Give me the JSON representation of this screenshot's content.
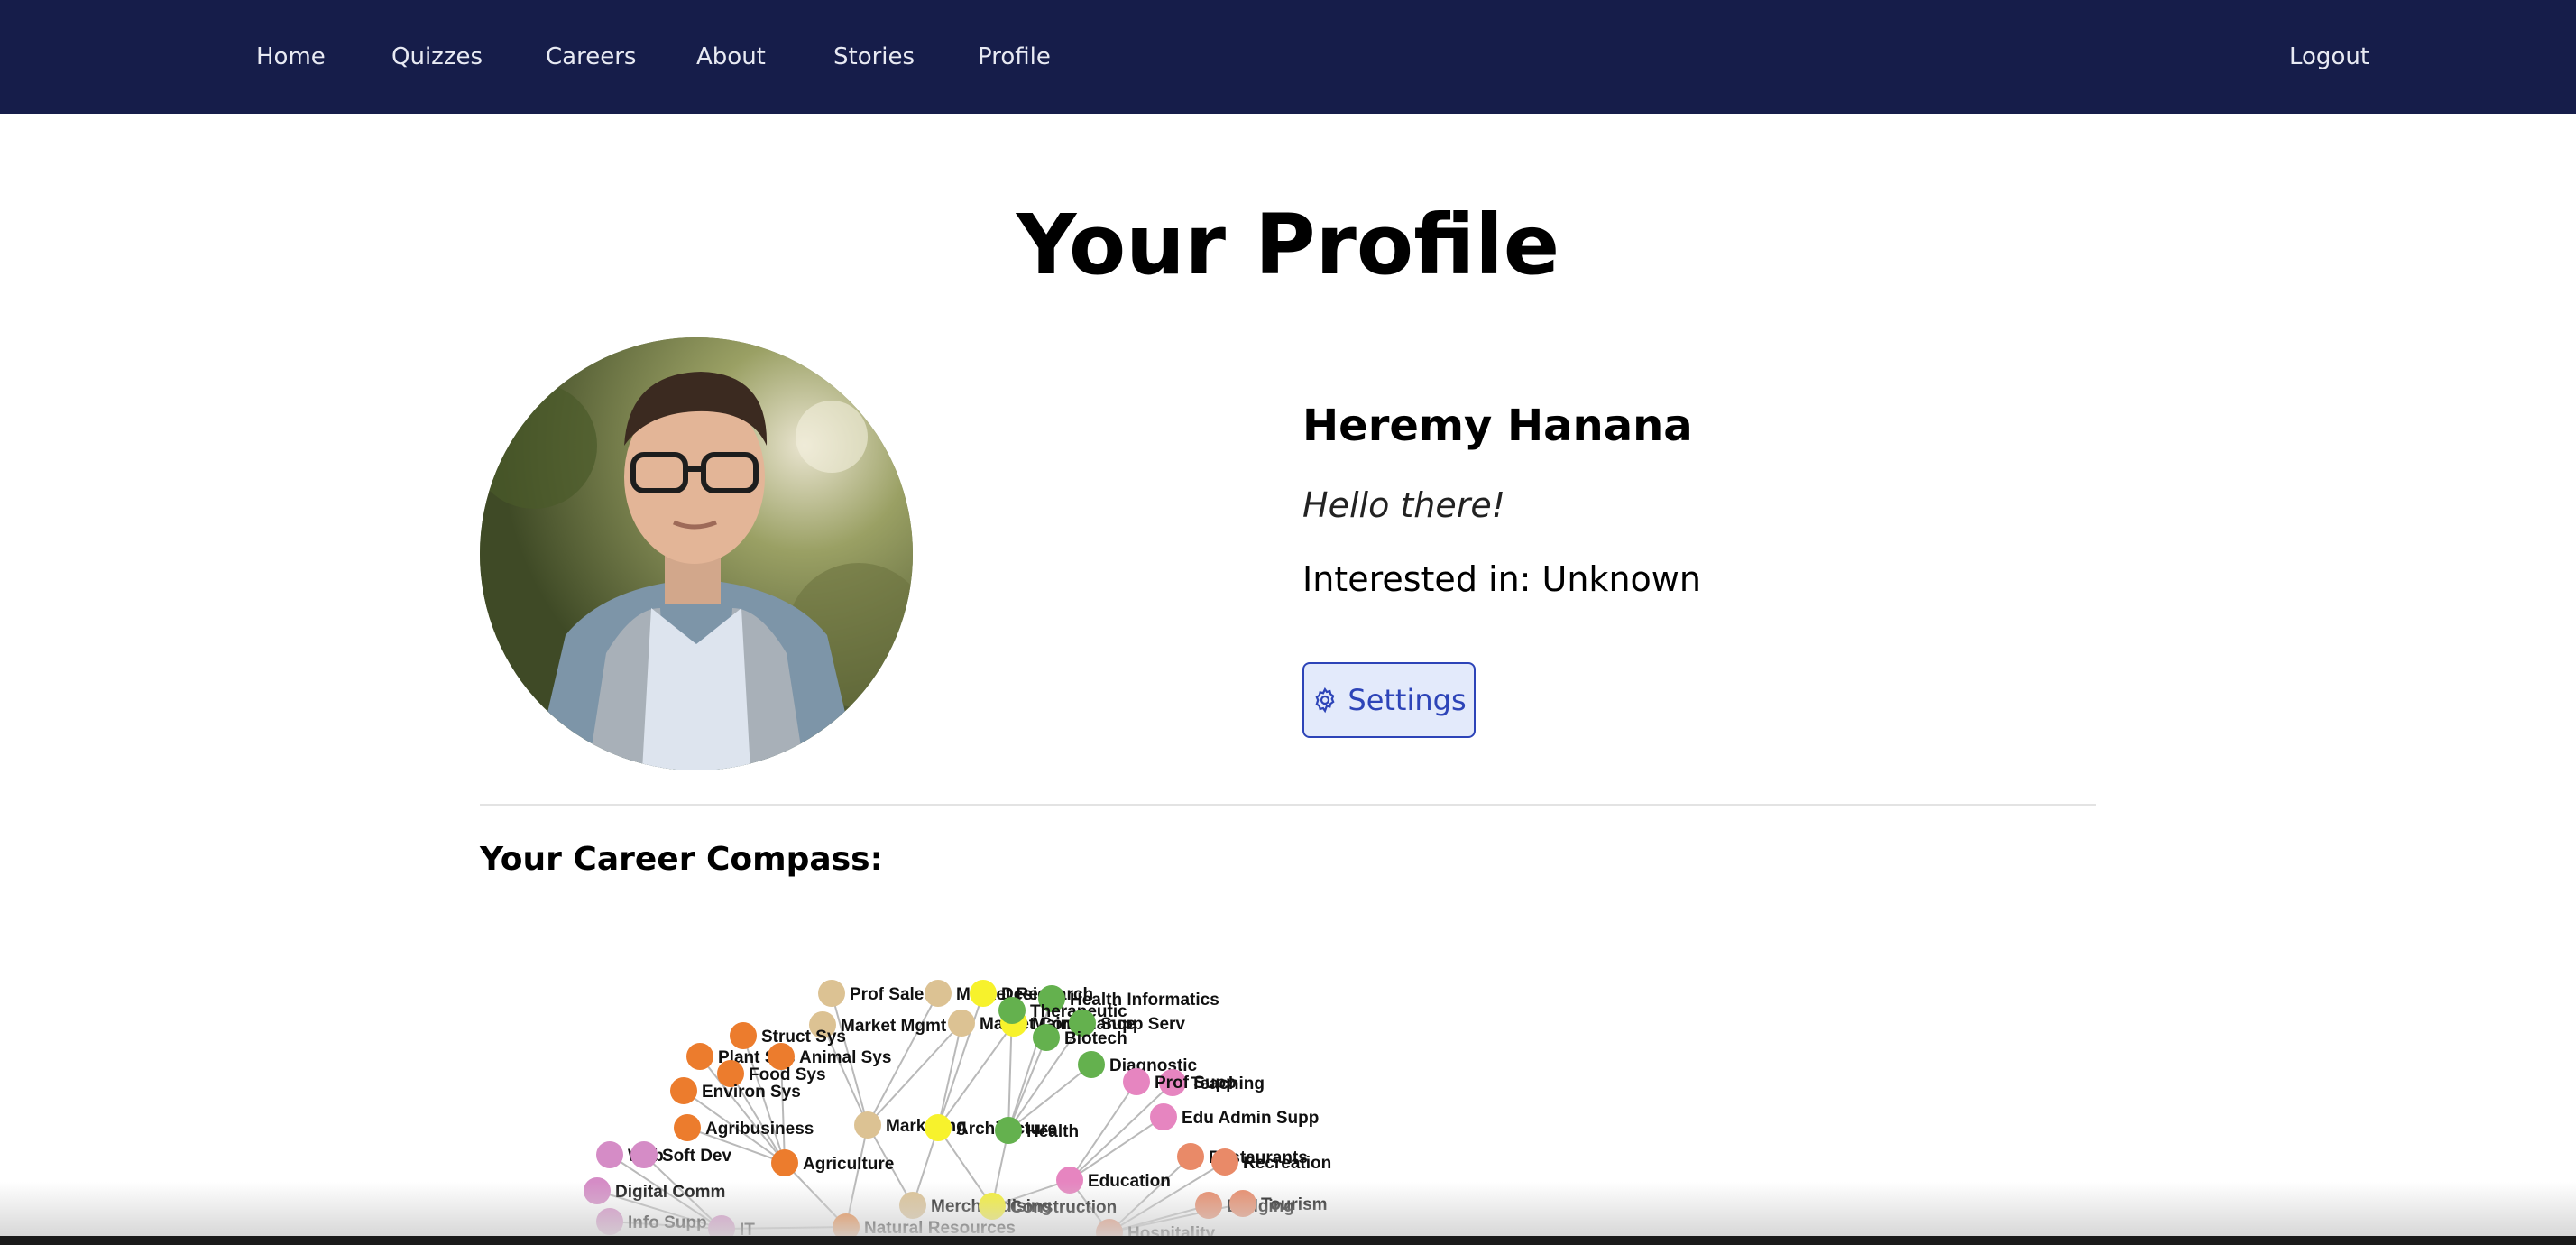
{
  "nav": {
    "links": [
      "Home",
      "Quizzes",
      "Careers",
      "About",
      "Stories",
      "Profile"
    ],
    "logout": "Logout"
  },
  "page": {
    "title": "Your Profile"
  },
  "profile": {
    "name": "Heremy Hanana",
    "greeting": "Hello there!",
    "interest": "Interested in: Unknown",
    "settings_label": "Settings",
    "settings_icon": "gear-icon"
  },
  "compass": {
    "label": "Your Career Compass:",
    "colors": {
      "business": "#dcc293",
      "architecture": "#f7f22c",
      "health": "#64b14e",
      "education": "#e685c0",
      "agriculture": "#ec7c2d",
      "hospitality": "#e98a68",
      "it": "#d58cc6"
    },
    "nodes": [
      {
        "id": "marketing",
        "label": "Marketing",
        "group": "business"
      },
      {
        "id": "prof-sales",
        "label": "Prof Sales",
        "group": "business"
      },
      {
        "id": "market-mgmt",
        "label": "Market Mgmt",
        "group": "business"
      },
      {
        "id": "market-research",
        "label": "Market Research",
        "group": "business"
      },
      {
        "id": "merchandising",
        "label": "Merchandising",
        "group": "business"
      },
      {
        "id": "market-comm",
        "label": "Market Comm",
        "group": "business"
      },
      {
        "id": "architecture",
        "label": "Architecture",
        "group": "architecture"
      },
      {
        "id": "design",
        "label": "Design",
        "group": "architecture"
      },
      {
        "id": "arch-maintenance",
        "label": "Maintenance",
        "group": "architecture"
      },
      {
        "id": "construction",
        "label": "Construction",
        "group": "architecture"
      },
      {
        "id": "health",
        "label": "Health",
        "group": "health"
      },
      {
        "id": "health-informatics",
        "label": "Health Informatics",
        "group": "health"
      },
      {
        "id": "therapeutic",
        "label": "Therapeutic",
        "group": "health"
      },
      {
        "id": "supp-serv",
        "label": "Supp Serv",
        "group": "health"
      },
      {
        "id": "biotech",
        "label": "Biotech",
        "group": "health"
      },
      {
        "id": "diagnostic",
        "label": "Diagnostic",
        "group": "health"
      },
      {
        "id": "education",
        "label": "Education",
        "group": "education"
      },
      {
        "id": "teaching",
        "label": "Teaching",
        "group": "education"
      },
      {
        "id": "prof-supp",
        "label": "Prof Supp",
        "group": "education"
      },
      {
        "id": "edu-admin-supp",
        "label": "Edu Admin Supp",
        "group": "education"
      },
      {
        "id": "agriculture",
        "label": "Agriculture",
        "group": "agriculture"
      },
      {
        "id": "struct-sys",
        "label": "Struct Sys",
        "group": "agriculture"
      },
      {
        "id": "plant-sys",
        "label": "Plant Sys",
        "group": "agriculture"
      },
      {
        "id": "animal-sys",
        "label": "Animal Sys",
        "group": "agriculture"
      },
      {
        "id": "food-sys",
        "label": "Food Sys",
        "group": "agriculture"
      },
      {
        "id": "environ-sys",
        "label": "Environ Sys",
        "group": "agriculture"
      },
      {
        "id": "agribusiness",
        "label": "Agribusiness",
        "group": "agriculture"
      },
      {
        "id": "natural-resources",
        "label": "Natural Resources",
        "group": "agriculture"
      },
      {
        "id": "hospitality",
        "label": "Hospitality",
        "group": "hospitality"
      },
      {
        "id": "restaurants",
        "label": "Restaurants",
        "group": "hospitality"
      },
      {
        "id": "recreation",
        "label": "Recreation",
        "group": "hospitality"
      },
      {
        "id": "lodging",
        "label": "Lodging",
        "group": "hospitality"
      },
      {
        "id": "tourism",
        "label": "Tourism",
        "group": "hospitality"
      },
      {
        "id": "it",
        "label": "IT",
        "group": "it"
      },
      {
        "id": "web",
        "label": "Web",
        "group": "it"
      },
      {
        "id": "soft-dev",
        "label": "Soft Dev",
        "group": "it"
      },
      {
        "id": "digital-comm",
        "label": "Digital Comm",
        "group": "it"
      },
      {
        "id": "info-supp",
        "label": "Info Supp",
        "group": "it"
      }
    ],
    "links": [
      [
        "marketing",
        "prof-sales"
      ],
      [
        "marketing",
        "market-mgmt"
      ],
      [
        "marketing",
        "market-research"
      ],
      [
        "marketing",
        "merchandising"
      ],
      [
        "marketing",
        "market-comm"
      ],
      [
        "marketing",
        "natural-resources"
      ],
      [
        "architecture",
        "design"
      ],
      [
        "architecture",
        "arch-maintenance"
      ],
      [
        "architecture",
        "construction"
      ],
      [
        "architecture",
        "market-comm"
      ],
      [
        "architecture",
        "merchandising"
      ],
      [
        "health",
        "health-informatics"
      ],
      [
        "health",
        "therapeutic"
      ],
      [
        "health",
        "supp-serv"
      ],
      [
        "health",
        "biotech"
      ],
      [
        "health",
        "diagnostic"
      ],
      [
        "health",
        "construction"
      ],
      [
        "education",
        "teaching"
      ],
      [
        "education",
        "prof-supp"
      ],
      [
        "education",
        "edu-admin-supp"
      ],
      [
        "education",
        "construction"
      ],
      [
        "education",
        "hospitality"
      ],
      [
        "agriculture",
        "struct-sys"
      ],
      [
        "agriculture",
        "plant-sys"
      ],
      [
        "agriculture",
        "animal-sys"
      ],
      [
        "agriculture",
        "food-sys"
      ],
      [
        "agriculture",
        "environ-sys"
      ],
      [
        "agriculture",
        "agribusiness"
      ],
      [
        "agriculture",
        "natural-resources"
      ],
      [
        "hospitality",
        "restaurants"
      ],
      [
        "hospitality",
        "recreation"
      ],
      [
        "hospitality",
        "lodging"
      ],
      [
        "hospitality",
        "tourism"
      ],
      [
        "it",
        "web"
      ],
      [
        "it",
        "soft-dev"
      ],
      [
        "it",
        "digital-comm"
      ],
      [
        "it",
        "info-supp"
      ],
      [
        "it",
        "natural-resources"
      ]
    ]
  }
}
